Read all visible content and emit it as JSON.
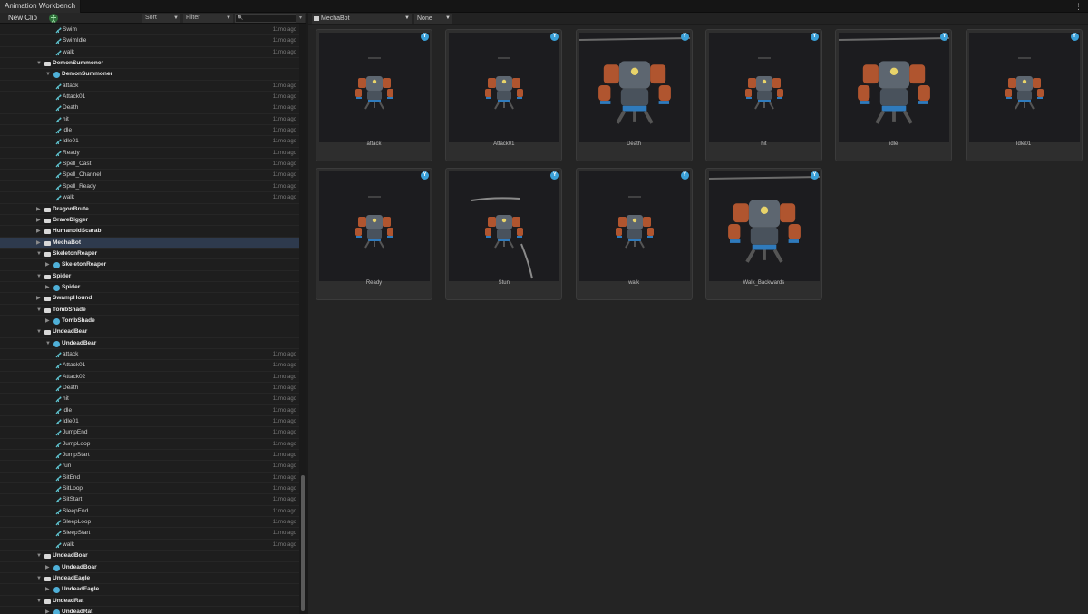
{
  "window": {
    "tab_title": "Animation Workbench",
    "menu_glyph": "⋮"
  },
  "left_toolbar": {
    "new_clip_label": "New Clip",
    "sort_label": "Sort",
    "filter_label": "Filter",
    "search_placeholder": "",
    "dropdown_arrow": "▼",
    "search_glyph": "🔍"
  },
  "tree": {
    "rows": [
      {
        "depth": 2,
        "kind": "anim",
        "label": "Swim",
        "time": "11mo ago"
      },
      {
        "depth": 2,
        "kind": "anim",
        "label": "SwimIdle",
        "time": "11mo ago"
      },
      {
        "depth": 2,
        "kind": "anim",
        "label": "walk",
        "time": "11mo ago"
      },
      {
        "depth": 0,
        "kind": "folder",
        "label": "DemonSummoner",
        "expanded": true
      },
      {
        "depth": 1,
        "kind": "model",
        "label": "DemonSummoner",
        "expanded": true
      },
      {
        "depth": 2,
        "kind": "anim",
        "label": "attack",
        "time": "11mo ago"
      },
      {
        "depth": 2,
        "kind": "anim",
        "label": "Attack01",
        "time": "11mo ago"
      },
      {
        "depth": 2,
        "kind": "anim",
        "label": "Death",
        "time": "11mo ago"
      },
      {
        "depth": 2,
        "kind": "anim",
        "label": "hit",
        "time": "11mo ago"
      },
      {
        "depth": 2,
        "kind": "anim",
        "label": "idle",
        "time": "11mo ago"
      },
      {
        "depth": 2,
        "kind": "anim",
        "label": "Idle01",
        "time": "11mo ago"
      },
      {
        "depth": 2,
        "kind": "anim",
        "label": "Ready",
        "time": "11mo ago"
      },
      {
        "depth": 2,
        "kind": "anim",
        "label": "Spell_Cast",
        "time": "11mo ago"
      },
      {
        "depth": 2,
        "kind": "anim",
        "label": "Spell_Channel",
        "time": "11mo ago"
      },
      {
        "depth": 2,
        "kind": "anim",
        "label": "Spell_Ready",
        "time": "11mo ago"
      },
      {
        "depth": 2,
        "kind": "anim",
        "label": "walk",
        "time": "11mo ago"
      },
      {
        "depth": 0,
        "kind": "folder",
        "label": "DragonBrute",
        "expanded": false
      },
      {
        "depth": 0,
        "kind": "folder",
        "label": "GraveDigger",
        "expanded": false
      },
      {
        "depth": 0,
        "kind": "folder",
        "label": "HumanoidScarab",
        "expanded": false
      },
      {
        "depth": 0,
        "kind": "folder",
        "label": "MechaBot",
        "expanded": false,
        "selected": true
      },
      {
        "depth": 0,
        "kind": "folder",
        "label": "SkeletonReaper",
        "expanded": true
      },
      {
        "depth": 1,
        "kind": "model",
        "label": "SkeletonReaper",
        "expanded": false
      },
      {
        "depth": 0,
        "kind": "folder",
        "label": "Spider",
        "expanded": true
      },
      {
        "depth": 1,
        "kind": "model",
        "label": "Spider",
        "expanded": false
      },
      {
        "depth": 0,
        "kind": "folder",
        "label": "SwampHound",
        "expanded": false
      },
      {
        "depth": 0,
        "kind": "folder",
        "label": "TombShade",
        "expanded": true
      },
      {
        "depth": 1,
        "kind": "model",
        "label": "TombShade",
        "expanded": false
      },
      {
        "depth": 0,
        "kind": "folder",
        "label": "UndeadBear",
        "expanded": true
      },
      {
        "depth": 1,
        "kind": "model",
        "label": "UndeadBear",
        "expanded": true
      },
      {
        "depth": 2,
        "kind": "anim",
        "label": "attack",
        "time": "11mo ago"
      },
      {
        "depth": 2,
        "kind": "anim",
        "label": "Attack01",
        "time": "11mo ago"
      },
      {
        "depth": 2,
        "kind": "anim",
        "label": "Attack02",
        "time": "11mo ago"
      },
      {
        "depth": 2,
        "kind": "anim",
        "label": "Death",
        "time": "11mo ago"
      },
      {
        "depth": 2,
        "kind": "anim",
        "label": "hit",
        "time": "11mo ago"
      },
      {
        "depth": 2,
        "kind": "anim",
        "label": "idle",
        "time": "11mo ago"
      },
      {
        "depth": 2,
        "kind": "anim",
        "label": "Idle01",
        "time": "11mo ago"
      },
      {
        "depth": 2,
        "kind": "anim",
        "label": "JumpEnd",
        "time": "11mo ago"
      },
      {
        "depth": 2,
        "kind": "anim",
        "label": "JumpLoop",
        "time": "11mo ago"
      },
      {
        "depth": 2,
        "kind": "anim",
        "label": "JumpStart",
        "time": "11mo ago"
      },
      {
        "depth": 2,
        "kind": "anim",
        "label": "run",
        "time": "11mo ago"
      },
      {
        "depth": 2,
        "kind": "anim",
        "label": "SitEnd",
        "time": "11mo ago"
      },
      {
        "depth": 2,
        "kind": "anim",
        "label": "SitLoop",
        "time": "11mo ago"
      },
      {
        "depth": 2,
        "kind": "anim",
        "label": "SitStart",
        "time": "11mo ago"
      },
      {
        "depth": 2,
        "kind": "anim",
        "label": "SleepEnd",
        "time": "11mo ago"
      },
      {
        "depth": 2,
        "kind": "anim",
        "label": "SleepLoop",
        "time": "11mo ago"
      },
      {
        "depth": 2,
        "kind": "anim",
        "label": "SleepStart",
        "time": "11mo ago"
      },
      {
        "depth": 2,
        "kind": "anim",
        "label": "walk",
        "time": "11mo ago"
      },
      {
        "depth": 0,
        "kind": "folder",
        "label": "UndeadBoar",
        "expanded": true
      },
      {
        "depth": 1,
        "kind": "model",
        "label": "UndeadBoar",
        "expanded": false
      },
      {
        "depth": 0,
        "kind": "folder",
        "label": "UndeadEagle",
        "expanded": true
      },
      {
        "depth": 1,
        "kind": "model",
        "label": "UndeadEagle",
        "expanded": false
      },
      {
        "depth": 0,
        "kind": "folder",
        "label": "UndeadRat",
        "expanded": true
      },
      {
        "depth": 1,
        "kind": "model",
        "label": "UndeadRat",
        "expanded": false
      }
    ]
  },
  "right_toolbar": {
    "model_selected": "MechaBot",
    "filter_selected": "None",
    "dropdown_arrow": "▼"
  },
  "grid": {
    "badge_glyph": "Y",
    "clips": [
      {
        "label": "attack",
        "pose": "small"
      },
      {
        "label": "Attack01",
        "pose": "small"
      },
      {
        "label": "Death",
        "pose": "large"
      },
      {
        "label": "hit",
        "pose": "small"
      },
      {
        "label": "idle",
        "pose": "large"
      },
      {
        "label": "Idle01",
        "pose": "small"
      },
      {
        "label": "Ready",
        "pose": "small"
      },
      {
        "label": "Stun",
        "pose": "stun"
      },
      {
        "label": "walk",
        "pose": "small"
      },
      {
        "label": "Walk_Backwards",
        "pose": "large"
      }
    ]
  },
  "colors": {
    "accent": "#3aa0d8",
    "anim_icon": "#5fc4d0",
    "selected_row": "#2e3a4d",
    "bot_orange": "#b0552f",
    "bot_steel": "#5d6670",
    "bot_blue": "#2f7bbd"
  }
}
